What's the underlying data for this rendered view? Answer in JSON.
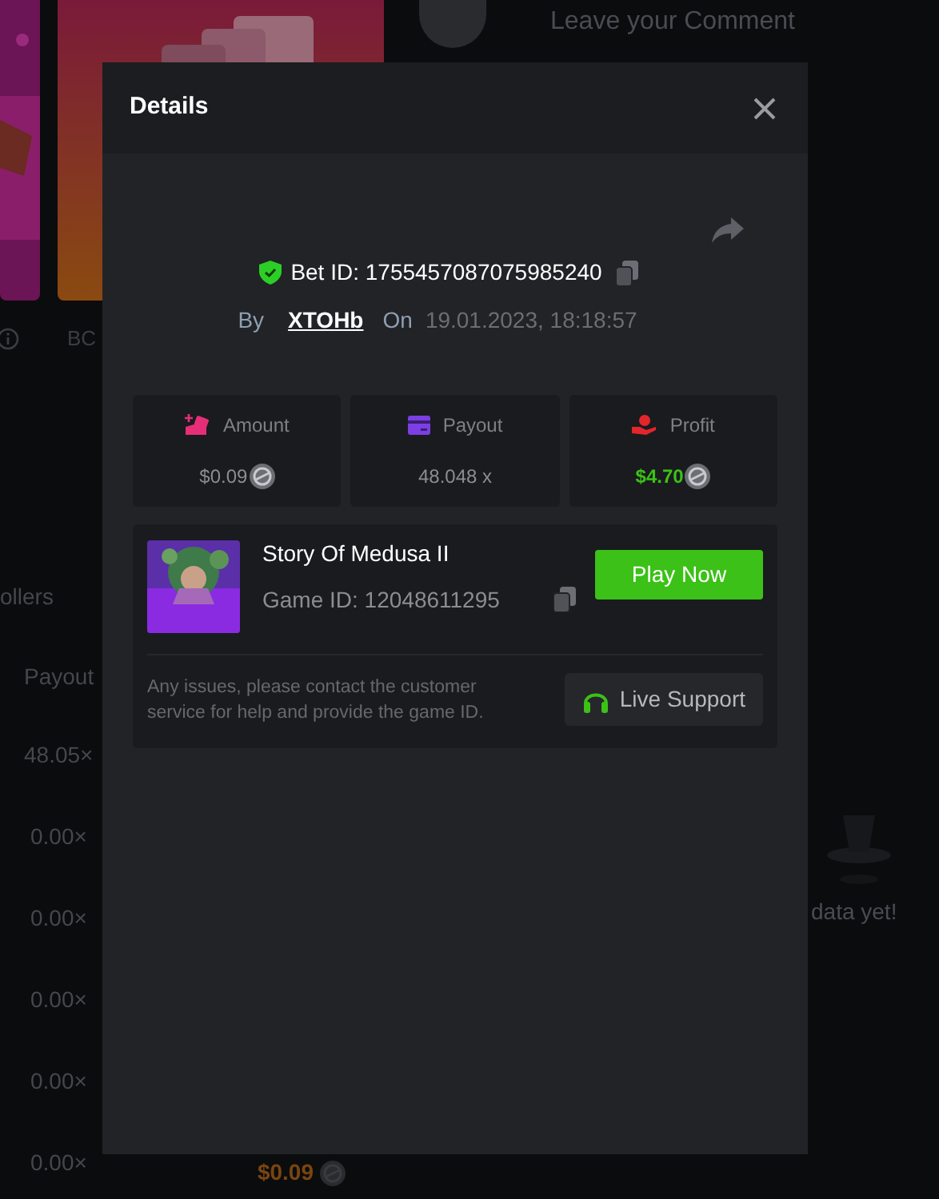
{
  "background": {
    "comment_placeholder": "Leave your Comment",
    "card_label": "BC",
    "tab_label": "ollers",
    "table": {
      "column": "Payout",
      "rows": [
        {
          "payout": "48.05×"
        },
        {
          "payout": "0.00×"
        },
        {
          "payout": "0.00×"
        },
        {
          "payout": "0.00×"
        },
        {
          "payout": "0.00×"
        },
        {
          "payout": "0.00×",
          "amount": "$0.09"
        }
      ]
    },
    "empty_text": "data yet!"
  },
  "modal": {
    "title": "Details",
    "bet_id": "Bet ID: 1755457087075985240",
    "by_label": "By",
    "user": "XTOHb",
    "on_label": "On",
    "date": "19.01.2023, 18:18:57",
    "stats": [
      {
        "kind": "amount",
        "label": "Amount",
        "value": "$0.09"
      },
      {
        "kind": "payout",
        "label": "Payout",
        "value": "48.048 x"
      },
      {
        "kind": "profit",
        "label": "Profit",
        "value": "$4.70"
      }
    ],
    "game": {
      "title": "Story Of Medusa II",
      "game_id": "Game ID: 12048611295",
      "play_button": "Play Now"
    },
    "support_text": "Any issues, please contact the customer service for help and provide the game ID.",
    "support_button": "Live Support"
  }
}
